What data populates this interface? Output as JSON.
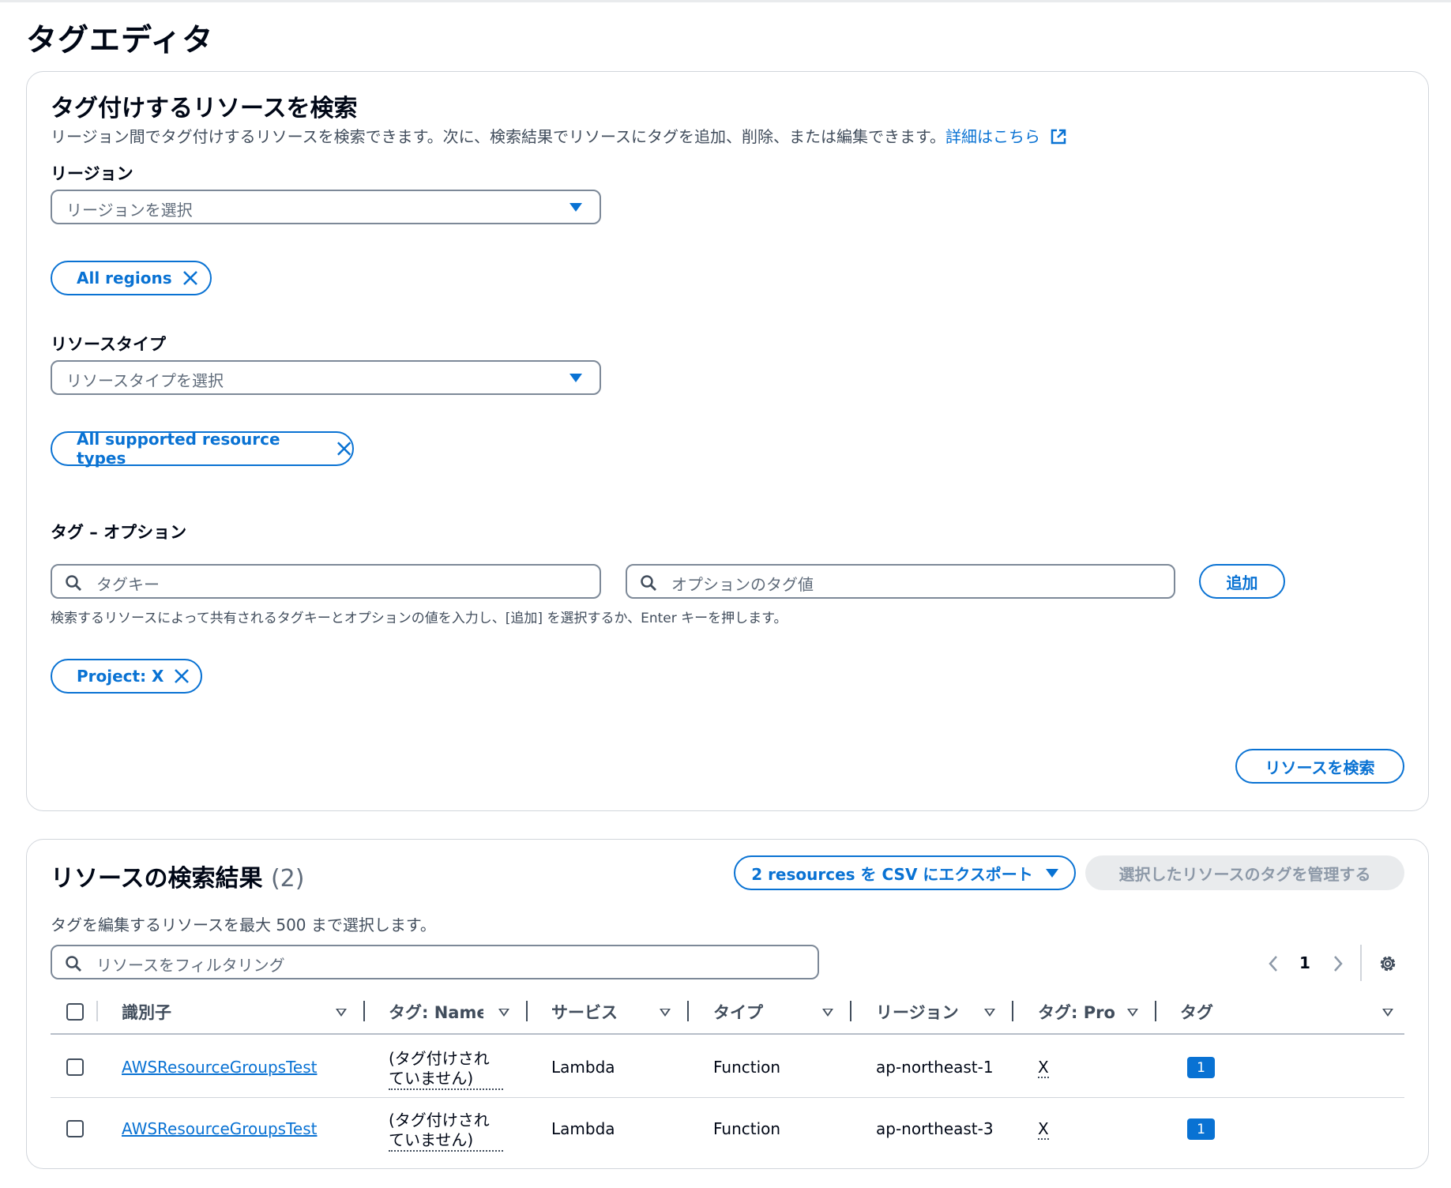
{
  "page": {
    "title": "タグエディタ"
  },
  "search_panel": {
    "title": "タグ付けするリソースを検索",
    "description": "リージョン間でタグ付けするリソースを検索できます。次に、検索結果でリソースにタグを追加、削除、または編集できます。",
    "learn_more_link": "詳細はこちら",
    "region_label": "リージョン",
    "region_placeholder": "リージョンを選択",
    "region_token": "All regions",
    "resource_type_label": "リソースタイプ",
    "resource_type_placeholder": "リソースタイプを選択",
    "resource_type_token": "All supported resource types",
    "tags_label": "タグ – オプション",
    "tag_key_placeholder": "タグキー",
    "tag_value_placeholder": "オプションのタグ値",
    "add_button": "追加",
    "tags_hint": "検索するリソースによって共有されるタグキーとオプションの値を入力し、[追加] を選択するか、Enter キーを押します。",
    "tag_token": "Project: X",
    "search_button": "リソースを検索"
  },
  "results_panel": {
    "title": "リソースの検索結果",
    "count": "(2)",
    "export_button": "2 resources を CSV にエクスポート",
    "manage_button": "選択したリソースのタグを管理する",
    "description": "タグを編集するリソースを最大 500 まで選択します。",
    "filter_placeholder": "リソースをフィルタリング",
    "page_number": "1",
    "columns": [
      "識別子",
      "タグ: Name",
      "サービス",
      "タイプ",
      "リージョン",
      "タグ: Project",
      "タグ"
    ],
    "rows": [
      {
        "identifier": "AWSResourceGroupsTest",
        "name_line1": "(タグ付けされ",
        "name_line2": "ていません)",
        "service": "Lambda",
        "type": "Function",
        "region": "ap-northeast-1",
        "project": "X",
        "tags": "1"
      },
      {
        "identifier": "AWSResourceGroupsTest",
        "name_line1": "(タグ付けされ",
        "name_line2": "ていません)",
        "service": "Lambda",
        "type": "Function",
        "region": "ap-northeast-3",
        "project": "X",
        "tags": "1"
      }
    ]
  },
  "colors": {
    "accent": "#0972d3",
    "border": "#7d8998",
    "disabled_bg": "#e9ebed"
  }
}
